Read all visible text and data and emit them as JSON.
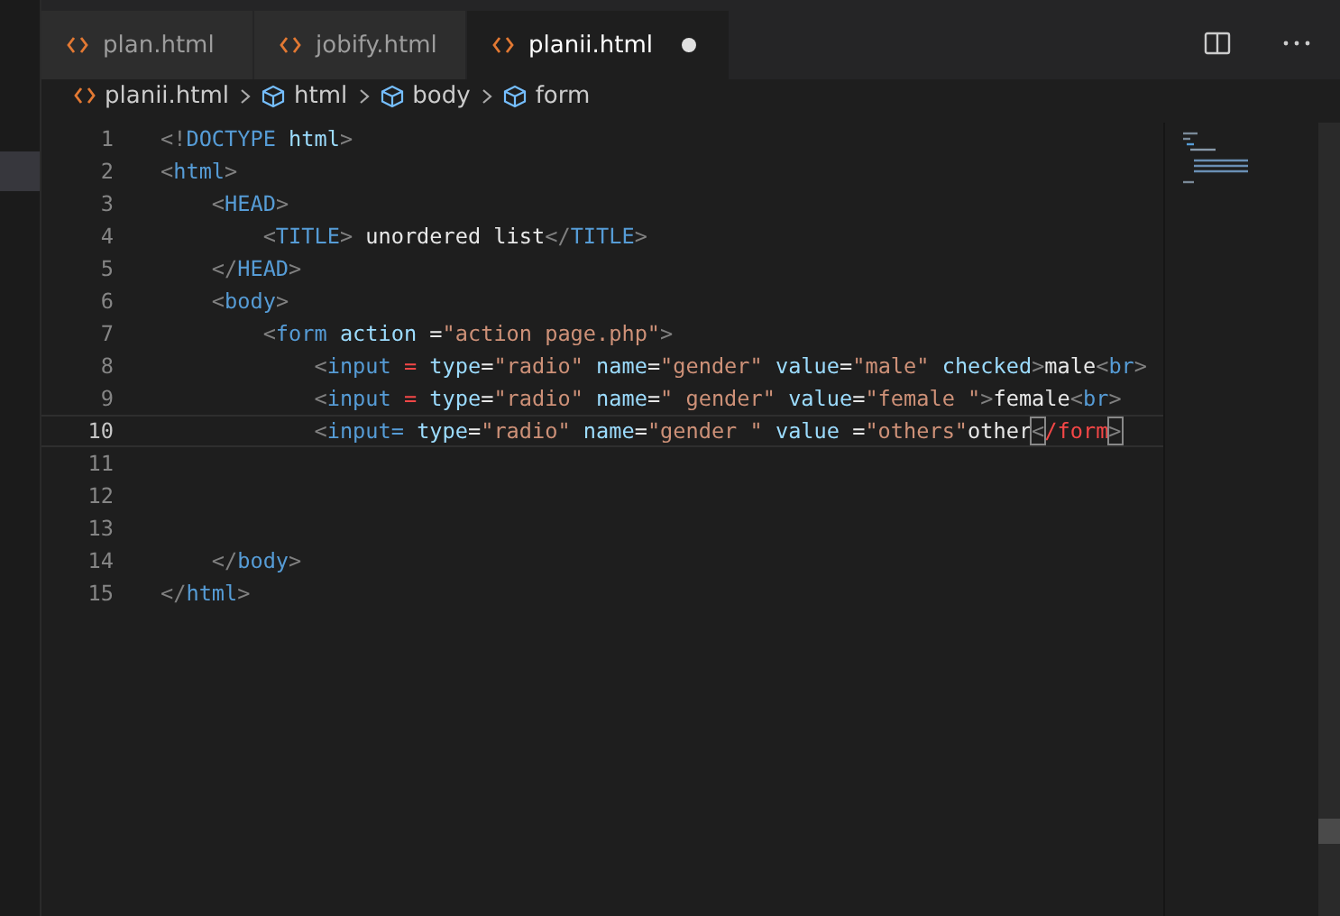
{
  "tabs": [
    {
      "label": "plan.html",
      "selected": false,
      "modified": false
    },
    {
      "label": "jobify.html",
      "selected": false,
      "modified": false
    },
    {
      "label": "planii.html",
      "selected": true,
      "modified": true
    }
  ],
  "breadcrumbs": [
    {
      "label": "planii.html",
      "kind": "file"
    },
    {
      "label": "html",
      "kind": "element"
    },
    {
      "label": "body",
      "kind": "element"
    },
    {
      "label": "form",
      "kind": "element"
    }
  ],
  "lines": [
    {
      "number": "1",
      "current": false,
      "tokens": [
        {
          "kind": "p",
          "text": "<!"
        },
        {
          "kind": "t",
          "text": "DOCTYPE"
        },
        {
          "kind": "a",
          "text": " html"
        },
        {
          "kind": "p",
          "text": ">"
        }
      ]
    },
    {
      "number": "2",
      "current": false,
      "tokens": [
        {
          "kind": "p",
          "text": "<"
        },
        {
          "kind": "t",
          "text": "html"
        },
        {
          "kind": "p",
          "text": ">"
        }
      ]
    },
    {
      "number": "3",
      "current": false,
      "tokens": [
        {
          "kind": "p",
          "text": "    <"
        },
        {
          "kind": "t",
          "text": "HEAD"
        },
        {
          "kind": "p",
          "text": ">"
        }
      ]
    },
    {
      "number": "4",
      "current": false,
      "tokens": [
        {
          "kind": "p",
          "text": "        <"
        },
        {
          "kind": "t",
          "text": "TITLE"
        },
        {
          "kind": "p",
          "text": ">"
        },
        {
          "kind": "x",
          "text": " unordered list"
        },
        {
          "kind": "p",
          "text": "</"
        },
        {
          "kind": "t",
          "text": "TITLE"
        },
        {
          "kind": "p",
          "text": ">"
        }
      ]
    },
    {
      "number": "5",
      "current": false,
      "tokens": [
        {
          "kind": "p",
          "text": "    </"
        },
        {
          "kind": "t",
          "text": "HEAD"
        },
        {
          "kind": "p",
          "text": ">"
        }
      ]
    },
    {
      "number": "6",
      "current": false,
      "tokens": [
        {
          "kind": "p",
          "text": "    <"
        },
        {
          "kind": "t",
          "text": "body"
        },
        {
          "kind": "p",
          "text": ">"
        }
      ]
    },
    {
      "number": "7",
      "current": false,
      "tokens": [
        {
          "kind": "p",
          "text": "        <"
        },
        {
          "kind": "t",
          "text": "form"
        },
        {
          "kind": "a",
          "text": " action"
        },
        {
          "kind": "x",
          "text": " ="
        },
        {
          "kind": "s",
          "text": "\"action page.php\""
        },
        {
          "kind": "p",
          "text": ">"
        }
      ]
    },
    {
      "number": "8",
      "current": false,
      "tokens": [
        {
          "kind": "p",
          "text": "            <"
        },
        {
          "kind": "t",
          "text": "input"
        },
        {
          "kind": "e",
          "text": " ="
        },
        {
          "kind": "a",
          "text": " type"
        },
        {
          "kind": "x",
          "text": "="
        },
        {
          "kind": "s",
          "text": "\"radio\""
        },
        {
          "kind": "a",
          "text": " name"
        },
        {
          "kind": "x",
          "text": "="
        },
        {
          "kind": "s",
          "text": "\"gender\""
        },
        {
          "kind": "a",
          "text": " value"
        },
        {
          "kind": "x",
          "text": "="
        },
        {
          "kind": "s",
          "text": "\"male\""
        },
        {
          "kind": "a",
          "text": " checked"
        },
        {
          "kind": "p",
          "text": ">"
        },
        {
          "kind": "x",
          "text": "male"
        },
        {
          "kind": "p",
          "text": "<"
        },
        {
          "kind": "t",
          "text": "br"
        },
        {
          "kind": "p",
          "text": ">"
        }
      ]
    },
    {
      "number": "9",
      "current": false,
      "tokens": [
        {
          "kind": "p",
          "text": "            <"
        },
        {
          "kind": "t",
          "text": "input"
        },
        {
          "kind": "e",
          "text": " ="
        },
        {
          "kind": "a",
          "text": " type"
        },
        {
          "kind": "x",
          "text": "="
        },
        {
          "kind": "s",
          "text": "\"radio\""
        },
        {
          "kind": "a",
          "text": " name"
        },
        {
          "kind": "x",
          "text": "="
        },
        {
          "kind": "s",
          "text": "\" gender\""
        },
        {
          "kind": "a",
          "text": " value"
        },
        {
          "kind": "x",
          "text": "="
        },
        {
          "kind": "s",
          "text": "\"female \""
        },
        {
          "kind": "p",
          "text": ">"
        },
        {
          "kind": "x",
          "text": "female"
        },
        {
          "kind": "p",
          "text": "<"
        },
        {
          "kind": "t",
          "text": "br"
        },
        {
          "kind": "p",
          "text": ">"
        }
      ]
    },
    {
      "number": "10",
      "current": true,
      "tokens": [
        {
          "kind": "p",
          "text": "            <"
        },
        {
          "kind": "t",
          "text": "input="
        },
        {
          "kind": "a",
          "text": " type"
        },
        {
          "kind": "x",
          "text": "="
        },
        {
          "kind": "s",
          "text": "\"radio\""
        },
        {
          "kind": "a",
          "text": " name"
        },
        {
          "kind": "x",
          "text": "="
        },
        {
          "kind": "s",
          "text": "\"gender \""
        },
        {
          "kind": "a",
          "text": " value"
        },
        {
          "kind": "x",
          "text": " ="
        },
        {
          "kind": "s",
          "text": "\"others\""
        },
        {
          "kind": "x",
          "text": "other"
        },
        {
          "kind": "m",
          "text": "<"
        },
        {
          "kind": "e",
          "text": "/form"
        },
        {
          "kind": "m",
          "text": ">"
        }
      ]
    },
    {
      "number": "11",
      "current": false
    },
    {
      "number": "12",
      "current": false
    },
    {
      "number": "13",
      "current": false
    },
    {
      "number": "14",
      "current": false,
      "tokens": [
        {
          "kind": "p",
          "text": "    </"
        },
        {
          "kind": "t",
          "text": "body"
        },
        {
          "kind": "p",
          "text": ">"
        }
      ]
    },
    {
      "number": "15",
      "current": false,
      "tokens": [
        {
          "kind": "p",
          "text": "</"
        },
        {
          "kind": "t",
          "text": "html"
        },
        {
          "kind": "p",
          "text": ">"
        }
      ]
    }
  ]
}
